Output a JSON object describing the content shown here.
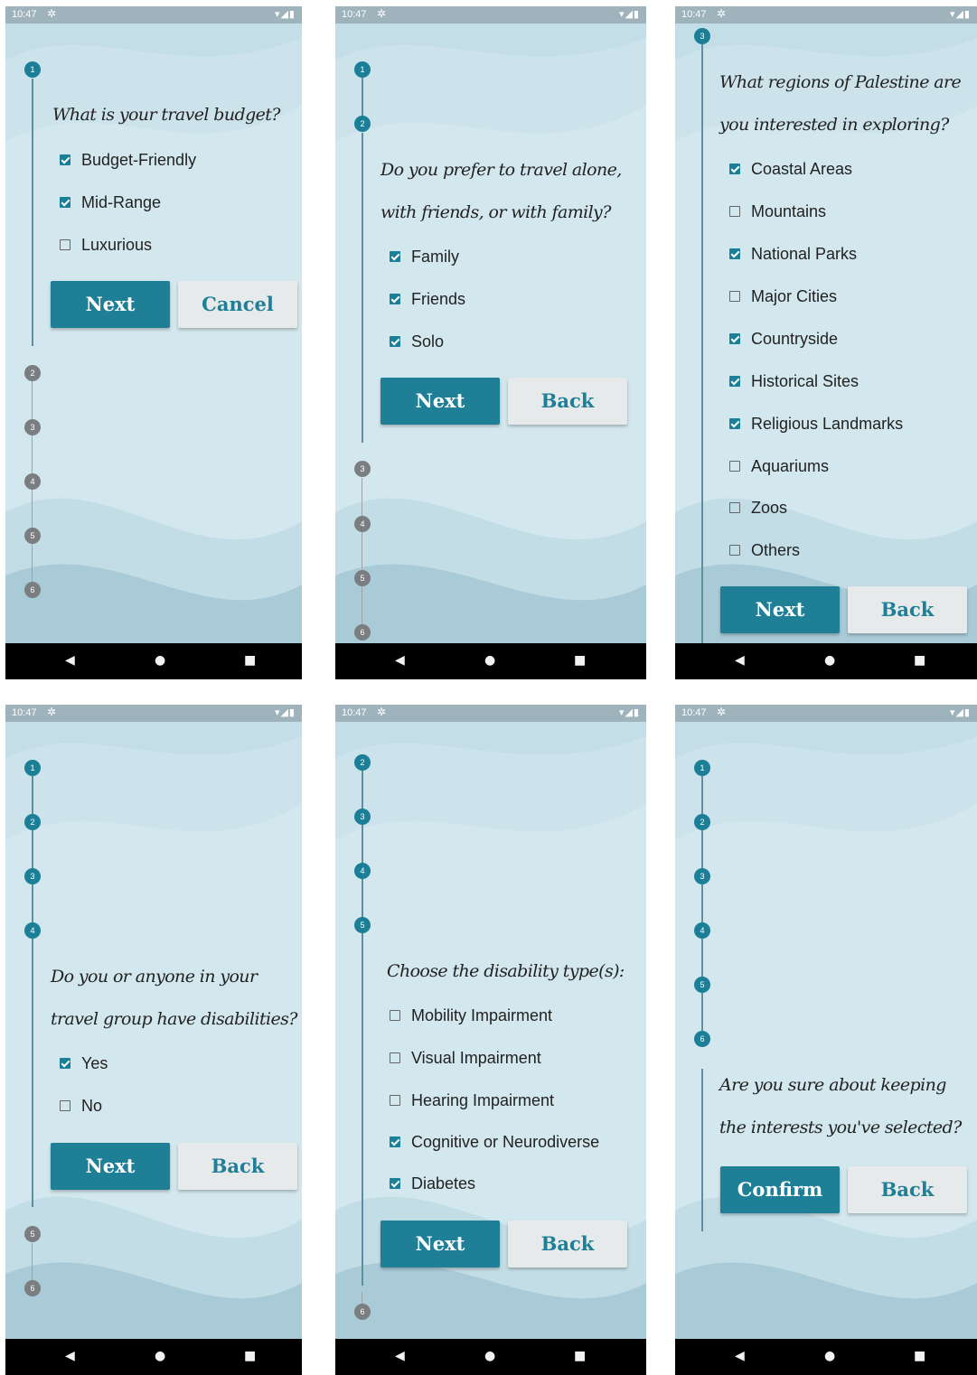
{
  "status_bar": {
    "time": "10:47"
  },
  "screens": [
    {
      "question_lines": [
        "What is your travel budget?"
      ],
      "options": [
        {
          "label": "Budget-Friendly",
          "checked": true
        },
        {
          "label": "Mid-Range",
          "checked": true
        },
        {
          "label": "Luxurious",
          "checked": false
        }
      ],
      "steps": [
        "1",
        "2",
        "3",
        "4",
        "5",
        "6"
      ],
      "primary_label": "Next",
      "secondary_label": "Cancel"
    },
    {
      "question_lines": [
        "Do you prefer to travel alone,",
        "with friends, or with family?"
      ],
      "options": [
        {
          "label": "Family",
          "checked": true
        },
        {
          "label": "Friends",
          "checked": true
        },
        {
          "label": "Solo",
          "checked": true
        }
      ],
      "steps": [
        "1",
        "2",
        "3",
        "4",
        "5",
        "6"
      ],
      "primary_label": "Next",
      "secondary_label": "Back"
    },
    {
      "question_lines": [
        "What regions of Palestine are",
        "you interested in exploring?"
      ],
      "options": [
        {
          "label": "Coastal Areas",
          "checked": true
        },
        {
          "label": "Mountains",
          "checked": false
        },
        {
          "label": "National Parks",
          "checked": true
        },
        {
          "label": "Major Cities",
          "checked": false
        },
        {
          "label": "Countryside",
          "checked": true
        },
        {
          "label": "Historical Sites",
          "checked": true
        },
        {
          "label": "Religious Landmarks",
          "checked": true
        },
        {
          "label": "Aquariums",
          "checked": false
        },
        {
          "label": "Zoos",
          "checked": false
        },
        {
          "label": "Others",
          "checked": false
        }
      ],
      "steps": [
        "3"
      ],
      "primary_label": "Next",
      "secondary_label": "Back"
    },
    {
      "question_lines": [
        "Do you or anyone in your",
        "travel group have disabilities?"
      ],
      "options": [
        {
          "label": "Yes",
          "checked": true
        },
        {
          "label": "No",
          "checked": false
        }
      ],
      "steps": [
        "1",
        "2",
        "3",
        "4",
        "5",
        "6"
      ],
      "primary_label": "Next",
      "secondary_label": "Back"
    },
    {
      "question_lines": [
        "Choose the disability type(s):"
      ],
      "options": [
        {
          "label": "Mobility Impairment",
          "checked": false
        },
        {
          "label": "Visual Impairment",
          "checked": false
        },
        {
          "label": "Hearing Impairment",
          "checked": false
        },
        {
          "label": "Cognitive or Neurodiverse",
          "checked": true
        },
        {
          "label": "Diabetes",
          "checked": true
        }
      ],
      "steps": [
        "2",
        "3",
        "4",
        "5",
        "6"
      ],
      "primary_label": "Next",
      "secondary_label": "Back"
    },
    {
      "question_lines": [
        "Are you sure about keeping",
        "the interests you've selected?"
      ],
      "options": [],
      "steps": [
        "1",
        "2",
        "3",
        "4",
        "5",
        "6"
      ],
      "primary_label": "Confirm",
      "secondary_label": "Back"
    }
  ]
}
